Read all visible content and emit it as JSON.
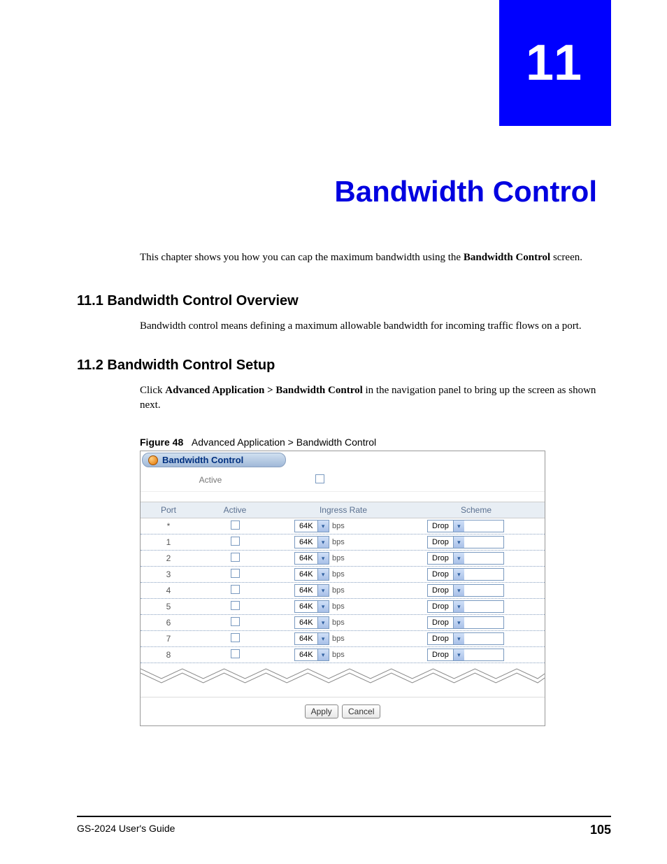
{
  "chapter": {
    "number": "11",
    "title": "Bandwidth Control"
  },
  "intro": {
    "text_pre": "This chapter shows you how you can cap the maximum bandwidth using the ",
    "bold": "Bandwidth Control",
    "text_post": " screen."
  },
  "sections": [
    {
      "heading": "11.1  Bandwidth Control Overview",
      "body": "Bandwidth control means defining a maximum allowable bandwidth for incoming traffic flows on a port."
    },
    {
      "heading": "11.2  Bandwidth Control Setup",
      "body_pre": "Click ",
      "body_bold": "Advanced Application > Bandwidth Control",
      "body_post": " in the navigation panel to bring up the screen as shown next."
    }
  ],
  "figure": {
    "label": "Figure 48",
    "caption": "Advanced Application > Bandwidth Control",
    "header": "Bandwidth Control",
    "active_label": "Active",
    "columns": {
      "port": "Port",
      "active": "Active",
      "ingress": "Ingress Rate",
      "scheme": "Scheme"
    },
    "unit": "bps",
    "rows": [
      {
        "port": "*",
        "rate": "64K",
        "scheme": "Drop"
      },
      {
        "port": "1",
        "rate": "64K",
        "scheme": "Drop"
      },
      {
        "port": "2",
        "rate": "64K",
        "scheme": "Drop"
      },
      {
        "port": "3",
        "rate": "64K",
        "scheme": "Drop"
      },
      {
        "port": "4",
        "rate": "64K",
        "scheme": "Drop"
      },
      {
        "port": "5",
        "rate": "64K",
        "scheme": "Drop"
      },
      {
        "port": "6",
        "rate": "64K",
        "scheme": "Drop"
      },
      {
        "port": "7",
        "rate": "64K",
        "scheme": "Drop"
      },
      {
        "port": "8",
        "rate": "64K",
        "scheme": "Drop"
      }
    ],
    "buttons": {
      "apply": "Apply",
      "cancel": "Cancel"
    }
  },
  "footer": {
    "left": "GS-2024 User's Guide",
    "page": "105"
  }
}
